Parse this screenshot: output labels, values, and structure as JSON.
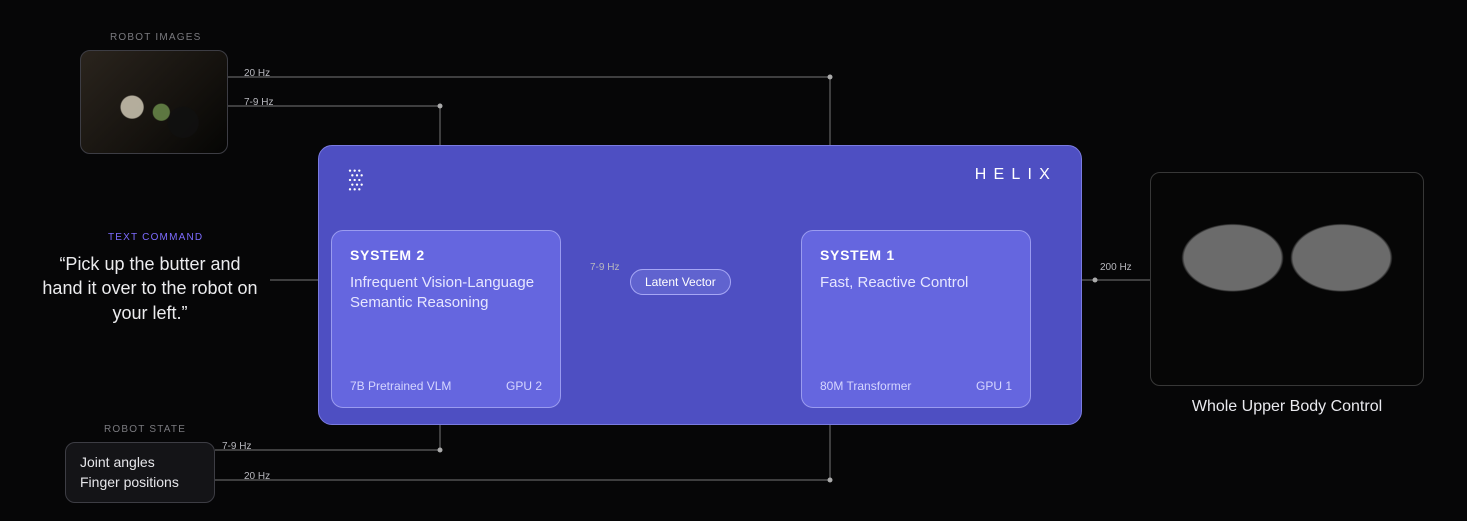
{
  "inputs": {
    "robot_images_label": "ROBOT IMAGES",
    "text_command_label": "TEXT COMMAND",
    "text_command_value": "“Pick up the butter and hand it over to the robot on your left.”",
    "robot_state_label": "ROBOT STATE",
    "robot_state_lines": [
      "Joint angles",
      "Finger positions"
    ]
  },
  "rates": {
    "image_to_sys1": "20 Hz",
    "image_to_sys2": "7-9 Hz",
    "state_to_sys2": "7-9 Hz",
    "state_to_sys1": "20 Hz",
    "latent": "7-9 Hz",
    "output": "200 Hz"
  },
  "helix": {
    "brand": "HELIX",
    "latent_label": "Latent Vector",
    "system2": {
      "title": "SYSTEM 2",
      "desc": "Infrequent Vision-Language Semantic Reasoning",
      "model": "7B Pretrained VLM",
      "gpu": "GPU 2"
    },
    "system1": {
      "title": "SYSTEM 1",
      "desc": "Fast, Reactive Control",
      "model": "80M Transformer",
      "gpu": "GPU 1"
    }
  },
  "output": {
    "caption": "Whole Upper Body Control"
  },
  "chart_data": {
    "type": "diagram",
    "nodes": [
      {
        "id": "robot_images",
        "kind": "input",
        "label": "ROBOT IMAGES"
      },
      {
        "id": "text_command",
        "kind": "input",
        "label": "TEXT COMMAND",
        "value": "Pick up the butter and hand it over to the robot on your left."
      },
      {
        "id": "robot_state",
        "kind": "input",
        "label": "ROBOT STATE",
        "value": "Joint angles, Finger positions"
      },
      {
        "id": "system2",
        "kind": "module",
        "label": "SYSTEM 2",
        "desc": "Infrequent Vision-Language Semantic Reasoning",
        "model": "7B Pretrained VLM",
        "device": "GPU 2"
      },
      {
        "id": "system1",
        "kind": "module",
        "label": "SYSTEM 1",
        "desc": "Fast, Reactive Control",
        "model": "80M Transformer",
        "device": "GPU 1"
      },
      {
        "id": "latent",
        "kind": "signal",
        "label": "Latent Vector"
      },
      {
        "id": "output",
        "kind": "output",
        "label": "Whole Upper Body Control"
      }
    ],
    "edges": [
      {
        "from": "robot_images",
        "to": "system2",
        "rate_hz": "7-9"
      },
      {
        "from": "robot_images",
        "to": "system1",
        "rate_hz": "20"
      },
      {
        "from": "text_command",
        "to": "system2"
      },
      {
        "from": "robot_state",
        "to": "system2",
        "rate_hz": "7-9"
      },
      {
        "from": "robot_state",
        "to": "system1",
        "rate_hz": "20"
      },
      {
        "from": "system2",
        "to": "latent",
        "rate_hz": "7-9"
      },
      {
        "from": "latent",
        "to": "system1"
      },
      {
        "from": "system1",
        "to": "output",
        "rate_hz": "200"
      }
    ],
    "container": "HELIX"
  }
}
